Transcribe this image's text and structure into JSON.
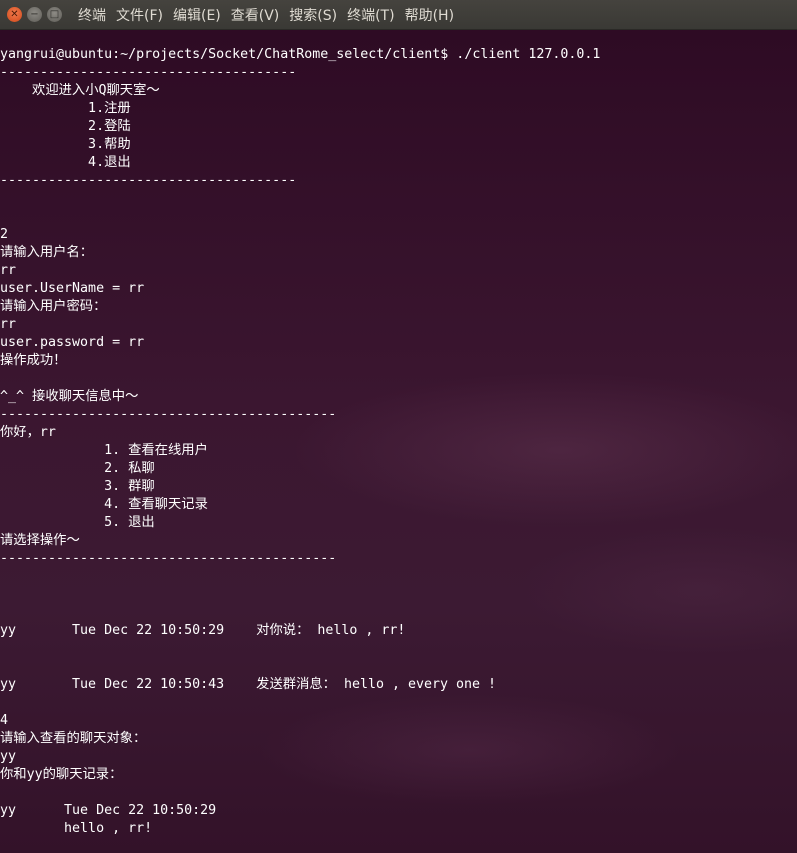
{
  "menubar": {
    "items": [
      "终端",
      "文件(F)",
      "编辑(E)",
      "查看(V)",
      "搜索(S)",
      "终端(T)",
      "帮助(H)"
    ]
  },
  "terminal": {
    "lines": [
      "yangrui@ubuntu:~/projects/Socket/ChatRome_select/client$ ./client 127.0.0.1",
      "-------------------------------------",
      "    欢迎进入小Q聊天室～",
      "           1.注册",
      "           2.登陆",
      "           3.帮助",
      "           4.退出",
      "-------------------------------------",
      "",
      "",
      "2",
      "请输入用户名：",
      "rr",
      "user.UserName = rr",
      "请输入用户密码：",
      "rr",
      "user.password = rr",
      "操作成功！",
      "",
      "^_^ 接收聊天信息中～",
      "------------------------------------------",
      "你好，rr",
      "             1. 查看在线用户",
      "             2. 私聊",
      "             3. 群聊",
      "             4. 查看聊天记录",
      "             5. 退出",
      "请选择操作～",
      "------------------------------------------",
      "",
      "",
      "",
      "yy       Tue Dec 22 10:50:29    对你说： hello , rr!",
      "",
      "",
      "yy       Tue Dec 22 10:50:43    发送群消息： hello , every one !",
      "",
      "4",
      "请输入查看的聊天对象：",
      "yy",
      "你和yy的聊天记录：",
      "",
      "yy      Tue Dec 22 10:50:29",
      "        hello , rr!"
    ]
  },
  "colors": {
    "terminal_text": "#ffffff",
    "terminal_bg": "#2c0f22",
    "titlebar_bg": "#3c3b37",
    "close_button": "#e95420"
  },
  "icons": {
    "close": "close-icon",
    "minimize": "minimize-icon",
    "maximize": "maximize-icon"
  }
}
